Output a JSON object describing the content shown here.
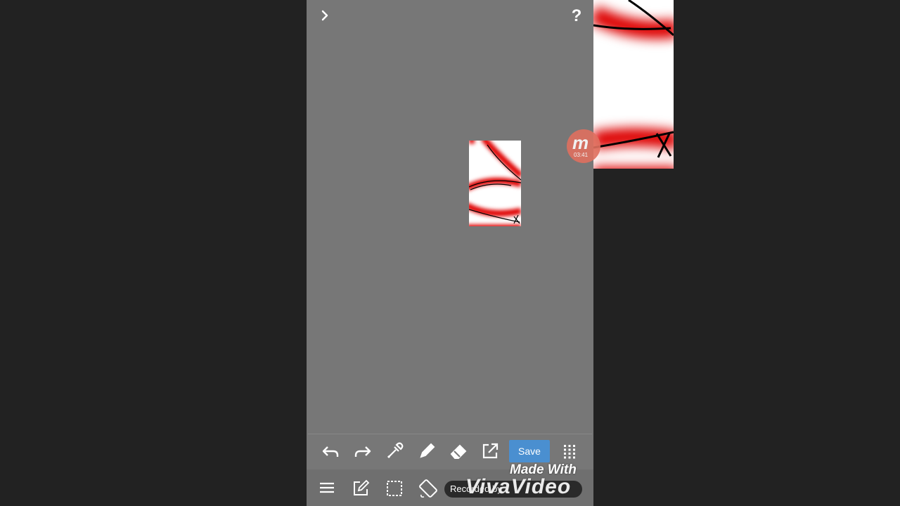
{
  "nav": {
    "expand_icon": "chevron-right-icon",
    "help_label": "?"
  },
  "recorder": {
    "logo_letter": "m",
    "timer": "03:41"
  },
  "toolbar": {
    "tools": [
      "undo-icon",
      "redo-icon",
      "eyedropper-icon",
      "pencil-icon",
      "eraser-icon",
      "open-external-icon",
      "grid-icon"
    ],
    "save_label": "Save",
    "accent": "#4a8fd0"
  },
  "bottombar": {
    "tools": [
      "menu-icon",
      "edit-icon",
      "selection-icon",
      "rotate-icon"
    ]
  },
  "watermark": {
    "line1": "Made With",
    "line2": "VivaVideo"
  },
  "recording_badge": {
    "label": "Recorded by"
  },
  "colors": {
    "background": "#222222",
    "canvas_area": "#777777",
    "art_red": "#e00000"
  }
}
